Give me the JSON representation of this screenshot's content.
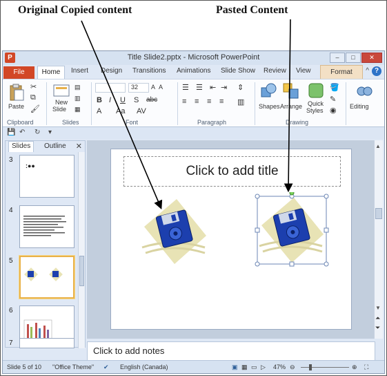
{
  "annotations": {
    "original": "Original Copied content",
    "pasted": "Pasted Content"
  },
  "window": {
    "title": "Title Slide2.pptx - Microsoft PowerPoint",
    "app_icon_letter": "P"
  },
  "tabs": {
    "file": "File",
    "home": "Home",
    "insert": "Insert",
    "design": "Design",
    "transitions": "Transitions",
    "animations": "Animations",
    "slide_show": "Slide Show",
    "review": "Review",
    "view": "View",
    "format": "Format"
  },
  "ribbon": {
    "paste": "Paste",
    "new_slide_1": "New",
    "new_slide_2": "Slide",
    "font_size": "32",
    "shapes": "Shapes",
    "arrange": "Arrange",
    "quick_styles_1": "Quick",
    "quick_styles_2": "Styles",
    "editing": "Editing",
    "groups": {
      "clipboard": "Clipboard",
      "slides": "Slides",
      "font": "Font",
      "paragraph": "Paragraph",
      "drawing": "Drawing"
    }
  },
  "panel": {
    "slides_tab": "Slides",
    "outline_tab": "Outline",
    "slide_numbers": [
      "3",
      "4",
      "5",
      "6",
      "7"
    ]
  },
  "slide": {
    "title_placeholder": "Click to add title"
  },
  "notes": {
    "placeholder": "Click to add notes"
  },
  "status": {
    "slide_count": "Slide 5 of 10",
    "theme": "\"Office Theme\"",
    "language": "English (Canada)",
    "zoom": "47%"
  },
  "colors": {
    "file_tab": "#d24726",
    "disk_blue": "#1c3fae",
    "clipart_beige": "#e8e3b5"
  }
}
